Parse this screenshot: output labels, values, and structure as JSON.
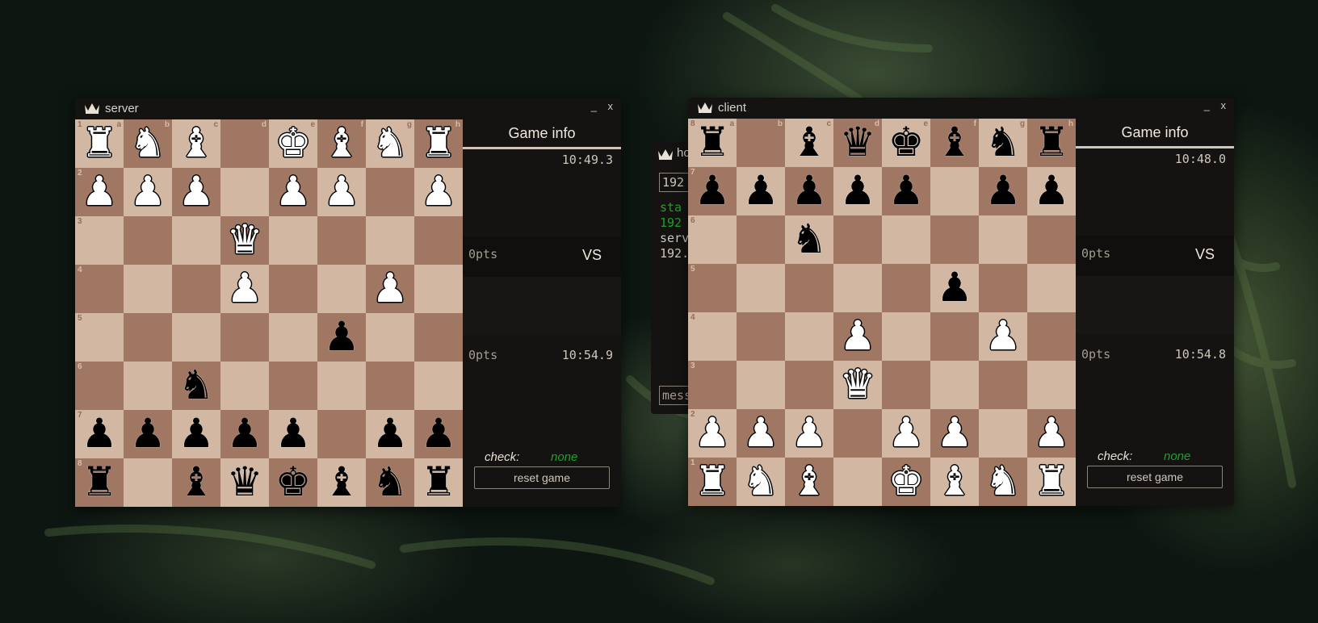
{
  "colors": {
    "light_square": "#d2b8a3",
    "dark_square": "#a07763",
    "check_value": "#1fa12a",
    "panel_bg": "#151312"
  },
  "piece_glyphs": {
    "wK": "♚",
    "wQ": "♛",
    "wR": "♜",
    "wB": "♝",
    "wN": "♞",
    "wP": "♟",
    "bK": "♚",
    "bQ": "♛",
    "bR": "♜",
    "bB": "♝",
    "bN": "♞",
    "bP": "♟"
  },
  "chat": {
    "title": "ho",
    "ip": "192",
    "log": [
      {
        "text": "sta",
        "color": "green"
      },
      {
        "text": "192",
        "color": "green"
      },
      {
        "text": "serv",
        "color": "normal"
      },
      {
        "text": "192.",
        "color": "normal"
      }
    ],
    "message_placeholder": "mess"
  },
  "windows": [
    {
      "id": "server",
      "title": "server",
      "minimize_label": "_",
      "close_label": "x",
      "file_labels": [
        "a",
        "b",
        "c",
        "d",
        "e",
        "f",
        "g",
        "h"
      ],
      "rank_labels": [
        "1",
        "2",
        "3",
        "4",
        "5",
        "6",
        "7",
        "8"
      ],
      "board": [
        [
          "wR",
          "wN",
          "wB",
          "",
          "wK",
          "wB",
          "wN",
          "wR"
        ],
        [
          "wP",
          "wP",
          "wP",
          "",
          "wP",
          "wP",
          "",
          "wP"
        ],
        [
          "",
          "",
          "",
          "wQ",
          "",
          "",
          "",
          ""
        ],
        [
          "",
          "",
          "",
          "wP",
          "",
          "",
          "wP",
          ""
        ],
        [
          "",
          "",
          "",
          "",
          "",
          "bP",
          "",
          ""
        ],
        [
          "",
          "",
          "bN",
          "",
          "",
          "",
          "",
          ""
        ],
        [
          "bP",
          "bP",
          "bP",
          "bP",
          "bP",
          "",
          "bP",
          "bP"
        ],
        [
          "bR",
          "",
          "bB",
          "bQ",
          "bK",
          "bB",
          "bN",
          "bR"
        ]
      ],
      "info": {
        "heading": "Game info",
        "top_timer": "10:49.3",
        "top_points": "0pts",
        "vs_label": "VS",
        "bottom_points": "0pts",
        "bottom_timer": "10:54.9",
        "check_label": "check:",
        "check_value": "none",
        "reset_label": "reset game"
      }
    },
    {
      "id": "client",
      "title": "client",
      "minimize_label": "_",
      "close_label": "x",
      "file_labels": [
        "a",
        "b",
        "c",
        "d",
        "e",
        "f",
        "g",
        "h"
      ],
      "rank_labels": [
        "8",
        "7",
        "6",
        "5",
        "4",
        "3",
        "2",
        "1"
      ],
      "board": [
        [
          "bR",
          "",
          "bB",
          "bQ",
          "bK",
          "bB",
          "bN",
          "bR"
        ],
        [
          "bP",
          "bP",
          "bP",
          "bP",
          "bP",
          "",
          "bP",
          "bP"
        ],
        [
          "",
          "",
          "bN",
          "",
          "",
          "",
          "",
          ""
        ],
        [
          "",
          "",
          "",
          "",
          "",
          "bP",
          "",
          ""
        ],
        [
          "",
          "",
          "",
          "wP",
          "",
          "",
          "wP",
          ""
        ],
        [
          "",
          "",
          "",
          "wQ",
          "",
          "",
          "",
          ""
        ],
        [
          "wP",
          "wP",
          "wP",
          "",
          "wP",
          "wP",
          "",
          "wP"
        ],
        [
          "wR",
          "wN",
          "wB",
          "",
          "wK",
          "wB",
          "wN",
          "wR"
        ]
      ],
      "info": {
        "heading": "Game info",
        "top_timer": "10:48.0",
        "top_points": "0pts",
        "vs_label": "VS",
        "bottom_points": "0pts",
        "bottom_timer": "10:54.8",
        "check_label": "check:",
        "check_value": "none",
        "reset_label": "reset game"
      }
    }
  ]
}
